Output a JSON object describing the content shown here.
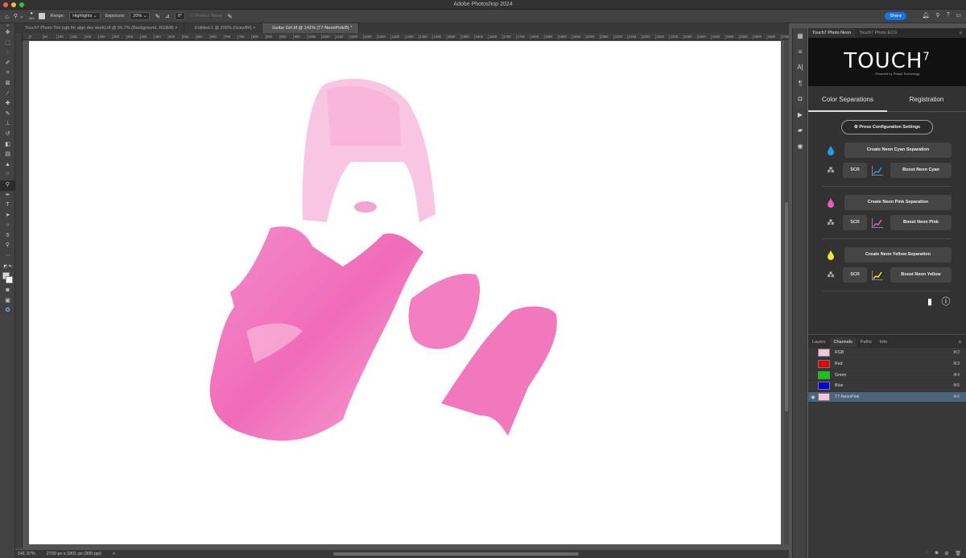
{
  "app_title": "Adobe Photoshop 2024",
  "options": {
    "brush_size": "150",
    "range_label": "Range:",
    "range_value": "Highlights",
    "exposure_label": "Exposure:",
    "exposure_value": "20%",
    "angle": "0°",
    "protect_tones": "Protect Tones",
    "share": "Share"
  },
  "doc_tabs": [
    "Touch7 Photo Tint (rgb for algo dev work).tif @ 66.7% (Background, RGB/8)",
    "Untitled-1 @ 200% (Gray/8#)",
    "Guitar Girl.tif @ 141% (T7-NeonPink/8) *"
  ],
  "ruler_ticks": [
    "0",
    "50",
    "100",
    "150",
    "200",
    "250",
    "300",
    "350",
    "400",
    "450",
    "500",
    "550",
    "600",
    "650",
    "700",
    "750",
    "800",
    "850",
    "900",
    "950",
    "1000",
    "1050",
    "1100",
    "1150",
    "1200",
    "1250",
    "1300",
    "1350",
    "1400",
    "1450",
    "1500",
    "1550",
    "1600",
    "1650",
    "1700",
    "1750",
    "1800",
    "1850",
    "1900",
    "1950",
    "2000",
    "2050",
    "2100",
    "2150",
    "2200",
    "2250",
    "2300",
    "2350",
    "2400",
    "2450",
    "2500",
    "2550",
    "2600",
    "2650",
    "2700"
  ],
  "status": {
    "zoom": "141.37%",
    "doc_info": "2700 px x 1801 px (300 ppi)",
    "arrow": ">"
  },
  "panel": {
    "tabs": [
      "Touch7 Photo Neon",
      "Touch7 Photo ECG"
    ],
    "logo_text": "TOUCH",
    "logo_sup": "7",
    "logo_sub": "Powered by Rhapti Technology",
    "section_tabs": [
      "Color Separations",
      "Registration"
    ],
    "config_button": "Press Configuration Settings",
    "groups": [
      {
        "create": "Create Neon Cyan Separation",
        "boost": "Boost Neon Cyan",
        "scr": "SCR",
        "color": "#1aa3e8"
      },
      {
        "create": "Create Neon Pink Separation",
        "boost": "Boost Neon Pink",
        "scr": "SCR",
        "color": "#f05ab4"
      },
      {
        "create": "Create Neon Yellow Separation",
        "boost": "Boost Neon Yellow",
        "scr": "SCR",
        "color": "#e8e83a"
      }
    ]
  },
  "channels": {
    "tabs": [
      "Layers",
      "Channels",
      "Paths",
      "Info"
    ],
    "rows": [
      {
        "name": "RGB",
        "key": "⌘2",
        "color": "#f4c6dc"
      },
      {
        "name": "Red",
        "key": "⌘3",
        "color": "#e00000"
      },
      {
        "name": "Green",
        "key": "⌘4",
        "color": "#00d000"
      },
      {
        "name": "Blue",
        "key": "⌘5",
        "color": "#0000e0"
      },
      {
        "name": "T7-NeonPink",
        "key": "⌘6",
        "color": "#f7c2df"
      }
    ]
  }
}
